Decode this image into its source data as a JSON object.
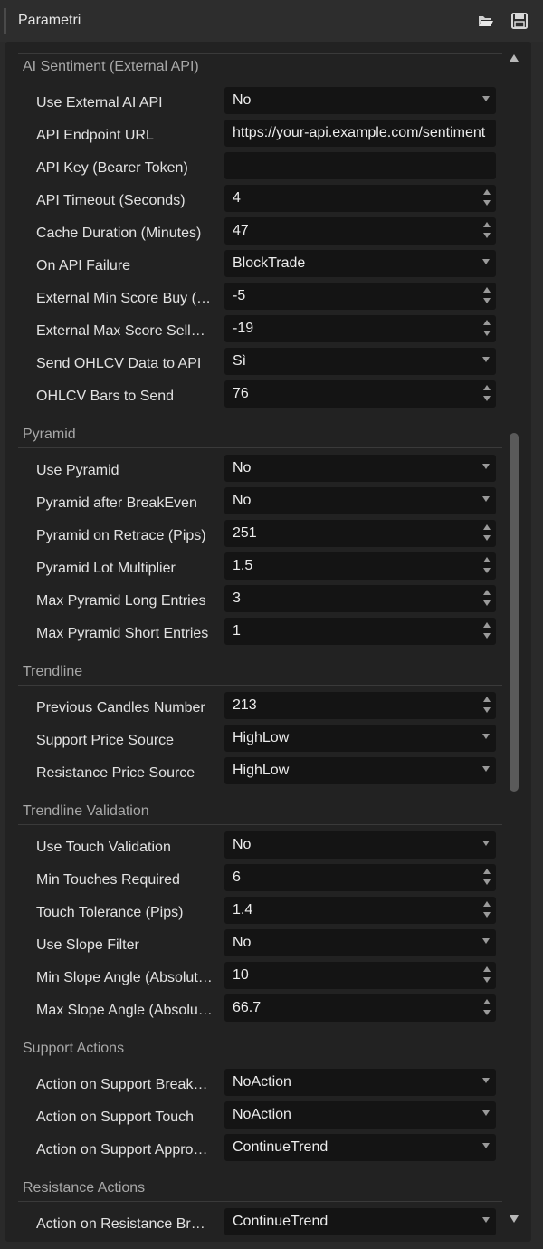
{
  "window": {
    "title": "Parametri",
    "icons": [
      "folder-open-icon",
      "save-icon"
    ]
  },
  "sections": [
    {
      "title": "AI Sentiment (External API)",
      "rows": [
        {
          "label": "Use External AI API",
          "value": "No",
          "control": "dropdown"
        },
        {
          "label": "API Endpoint URL",
          "value": "https://your-api.example.com/sentiment",
          "control": "text"
        },
        {
          "label": "API Key (Bearer Token)",
          "value": "",
          "control": "text"
        },
        {
          "label": "API Timeout (Seconds)",
          "value": "4",
          "control": "spinner"
        },
        {
          "label": "Cache Duration (Minutes)",
          "value": "47",
          "control": "spinner"
        },
        {
          "label": "On API Failure",
          "value": "BlockTrade",
          "control": "dropdown"
        },
        {
          "label": "External Min Score Buy (…",
          "value": "-5",
          "control": "spinner"
        },
        {
          "label": "External Max Score Sell…",
          "value": "-19",
          "control": "spinner"
        },
        {
          "label": "Send OHLCV Data to API",
          "value": "Sì",
          "control": "dropdown"
        },
        {
          "label": "OHLCV Bars to Send",
          "value": "76",
          "control": "spinner"
        }
      ]
    },
    {
      "title": "Pyramid",
      "rows": [
        {
          "label": "Use Pyramid",
          "value": "No",
          "control": "dropdown"
        },
        {
          "label": "Pyramid after BreakEven",
          "value": "No",
          "control": "dropdown"
        },
        {
          "label": "Pyramid on Retrace (Pips)",
          "value": "251",
          "control": "spinner"
        },
        {
          "label": "Pyramid Lot Multiplier",
          "value": "1.5",
          "control": "spinner"
        },
        {
          "label": "Max Pyramid Long Entries",
          "value": "3",
          "control": "spinner"
        },
        {
          "label": "Max Pyramid Short Entries",
          "value": "1",
          "control": "spinner"
        }
      ]
    },
    {
      "title": "Trendline",
      "rows": [
        {
          "label": "Previous Candles Number",
          "value": "213",
          "control": "spinner"
        },
        {
          "label": "Support Price Source",
          "value": "HighLow",
          "control": "dropdown"
        },
        {
          "label": "Resistance Price Source",
          "value": "HighLow",
          "control": "dropdown"
        }
      ]
    },
    {
      "title": "Trendline Validation",
      "rows": [
        {
          "label": "Use Touch Validation",
          "value": "No",
          "control": "dropdown"
        },
        {
          "label": "Min Touches Required",
          "value": "6",
          "control": "spinner"
        },
        {
          "label": "Touch Tolerance (Pips)",
          "value": "1.4",
          "control": "spinner"
        },
        {
          "label": "Use Slope Filter",
          "value": "No",
          "control": "dropdown"
        },
        {
          "label": "Min Slope Angle (Absolut…",
          "value": "10",
          "control": "spinner"
        },
        {
          "label": "Max Slope Angle (Absolu…",
          "value": "66.7",
          "control": "spinner"
        }
      ]
    },
    {
      "title": "Support Actions",
      "rows": [
        {
          "label": "Action on Support Break…",
          "value": "NoAction",
          "control": "dropdown"
        },
        {
          "label": "Action on Support Touch",
          "value": "NoAction",
          "control": "dropdown"
        },
        {
          "label": "Action on Support Appro…",
          "value": "ContinueTrend",
          "control": "dropdown"
        }
      ]
    },
    {
      "title": "Resistance Actions",
      "rows": [
        {
          "label": "Action on Resistance Br…",
          "value": "ContinueTrend",
          "control": "dropdown"
        }
      ]
    }
  ]
}
